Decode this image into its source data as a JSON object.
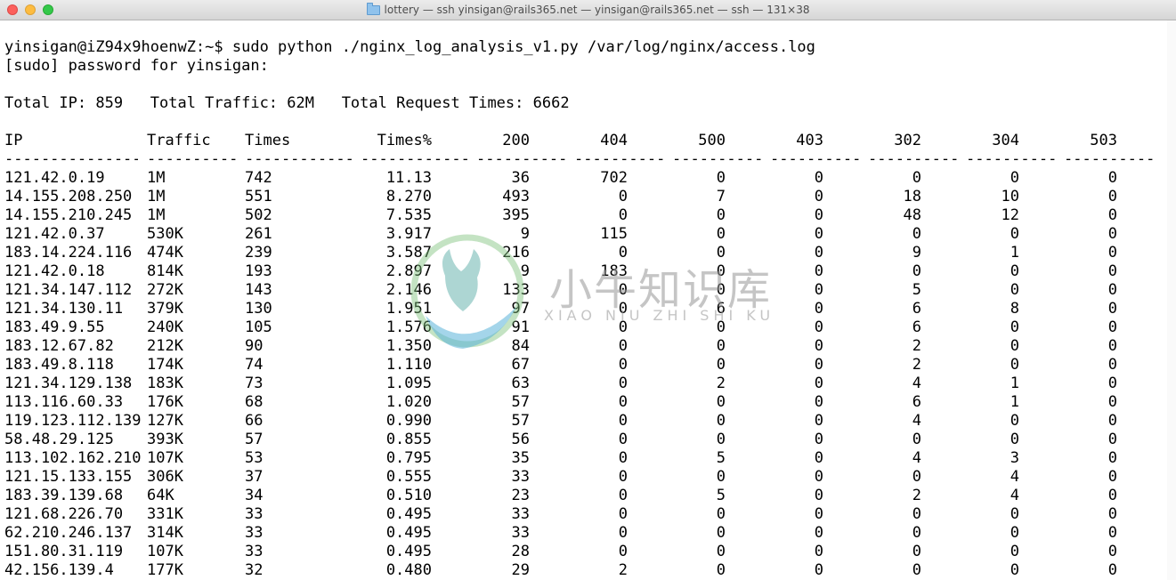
{
  "window": {
    "title": "lottery — ssh yinsigan@rails365.net — yinsigan@rails365.net — ssh — 131×38",
    "close_color": "#fc605c",
    "minimize_color": "#fdbc40",
    "maximize_color": "#34c84a"
  },
  "terminal": {
    "command_line": "yinsigan@iZ94x9hoenwZ:~$ sudo python ./nginx_log_analysis_v1.py /var/log/nginx/access.log",
    "sudo_prompt": "[sudo] password for yinsigan:",
    "summary": "Total IP: 859   Total Traffic: 62M   Total Request Times: 6662",
    "table": {
      "headers": {
        "ip": "IP",
        "traffic": "Traffic",
        "times": "Times",
        "pct": "Times%",
        "s200": "200",
        "s404": "404",
        "s500": "500",
        "s403": "403",
        "s302": "302",
        "s304": "304",
        "s503": "503"
      },
      "separators": {
        "ip": "---------------",
        "traffic": "----------",
        "times": "------------",
        "pct": "------------",
        "s200": "----------",
        "s404": "----------",
        "s500": "----------",
        "s403": "----------",
        "s302": "----------",
        "s304": "----------",
        "s503": "----------"
      },
      "rows": [
        {
          "ip": "121.42.0.19",
          "traffic": "1M",
          "times": "742",
          "pct": "11.13",
          "s200": "36",
          "s404": "702",
          "s500": "0",
          "s403": "0",
          "s302": "0",
          "s304": "0",
          "s503": "0"
        },
        {
          "ip": "14.155.208.250",
          "traffic": "1M",
          "times": "551",
          "pct": "8.270",
          "s200": "493",
          "s404": "0",
          "s500": "7",
          "s403": "0",
          "s302": "18",
          "s304": "10",
          "s503": "0"
        },
        {
          "ip": "14.155.210.245",
          "traffic": "1M",
          "times": "502",
          "pct": "7.535",
          "s200": "395",
          "s404": "0",
          "s500": "0",
          "s403": "0",
          "s302": "48",
          "s304": "12",
          "s503": "0"
        },
        {
          "ip": "121.42.0.37",
          "traffic": "530K",
          "times": "261",
          "pct": "3.917",
          "s200": "9",
          "s404": "115",
          "s500": "0",
          "s403": "0",
          "s302": "0",
          "s304": "0",
          "s503": "0"
        },
        {
          "ip": "183.14.224.116",
          "traffic": "474K",
          "times": "239",
          "pct": "3.587",
          "s200": "216",
          "s404": "0",
          "s500": "0",
          "s403": "0",
          "s302": "9",
          "s304": "1",
          "s503": "0"
        },
        {
          "ip": "121.42.0.18",
          "traffic": "814K",
          "times": "193",
          "pct": "2.897",
          "s200": "9",
          "s404": "183",
          "s500": "0",
          "s403": "0",
          "s302": "0",
          "s304": "0",
          "s503": "0"
        },
        {
          "ip": "121.34.147.112",
          "traffic": "272K",
          "times": "143",
          "pct": "2.146",
          "s200": "133",
          "s404": "0",
          "s500": "0",
          "s403": "0",
          "s302": "5",
          "s304": "0",
          "s503": "0"
        },
        {
          "ip": "121.34.130.11",
          "traffic": "379K",
          "times": "130",
          "pct": "1.951",
          "s200": "97",
          "s404": "0",
          "s500": "6",
          "s403": "0",
          "s302": "6",
          "s304": "8",
          "s503": "0"
        },
        {
          "ip": "183.49.9.55",
          "traffic": "240K",
          "times": "105",
          "pct": "1.576",
          "s200": "91",
          "s404": "0",
          "s500": "0",
          "s403": "0",
          "s302": "6",
          "s304": "0",
          "s503": "0"
        },
        {
          "ip": "183.12.67.82",
          "traffic": "212K",
          "times": "90",
          "pct": "1.350",
          "s200": "84",
          "s404": "0",
          "s500": "0",
          "s403": "0",
          "s302": "2",
          "s304": "0",
          "s503": "0"
        },
        {
          "ip": "183.49.8.118",
          "traffic": "174K",
          "times": "74",
          "pct": "1.110",
          "s200": "67",
          "s404": "0",
          "s500": "0",
          "s403": "0",
          "s302": "2",
          "s304": "0",
          "s503": "0"
        },
        {
          "ip": "121.34.129.138",
          "traffic": "183K",
          "times": "73",
          "pct": "1.095",
          "s200": "63",
          "s404": "0",
          "s500": "2",
          "s403": "0",
          "s302": "4",
          "s304": "1",
          "s503": "0"
        },
        {
          "ip": "113.116.60.33",
          "traffic": "176K",
          "times": "68",
          "pct": "1.020",
          "s200": "57",
          "s404": "0",
          "s500": "0",
          "s403": "0",
          "s302": "6",
          "s304": "1",
          "s503": "0"
        },
        {
          "ip": "119.123.112.139",
          "traffic": "127K",
          "times": "66",
          "pct": "0.990",
          "s200": "57",
          "s404": "0",
          "s500": "0",
          "s403": "0",
          "s302": "4",
          "s304": "0",
          "s503": "0"
        },
        {
          "ip": "58.48.29.125",
          "traffic": "393K",
          "times": "57",
          "pct": "0.855",
          "s200": "56",
          "s404": "0",
          "s500": "0",
          "s403": "0",
          "s302": "0",
          "s304": "0",
          "s503": "0"
        },
        {
          "ip": "113.102.162.210",
          "traffic": "107K",
          "times": "53",
          "pct": "0.795",
          "s200": "35",
          "s404": "0",
          "s500": "5",
          "s403": "0",
          "s302": "4",
          "s304": "3",
          "s503": "0"
        },
        {
          "ip": "121.15.133.155",
          "traffic": "306K",
          "times": "37",
          "pct": "0.555",
          "s200": "33",
          "s404": "0",
          "s500": "0",
          "s403": "0",
          "s302": "0",
          "s304": "4",
          "s503": "0"
        },
        {
          "ip": "183.39.139.68",
          "traffic": "64K",
          "times": "34",
          "pct": "0.510",
          "s200": "23",
          "s404": "0",
          "s500": "5",
          "s403": "0",
          "s302": "2",
          "s304": "4",
          "s503": "0"
        },
        {
          "ip": "121.68.226.70",
          "traffic": "331K",
          "times": "33",
          "pct": "0.495",
          "s200": "33",
          "s404": "0",
          "s500": "0",
          "s403": "0",
          "s302": "0",
          "s304": "0",
          "s503": "0"
        },
        {
          "ip": "62.210.246.137",
          "traffic": "314K",
          "times": "33",
          "pct": "0.495",
          "s200": "33",
          "s404": "0",
          "s500": "0",
          "s403": "0",
          "s302": "0",
          "s304": "0",
          "s503": "0"
        },
        {
          "ip": "151.80.31.119",
          "traffic": "107K",
          "times": "33",
          "pct": "0.495",
          "s200": "28",
          "s404": "0",
          "s500": "0",
          "s403": "0",
          "s302": "0",
          "s304": "0",
          "s503": "0"
        },
        {
          "ip": "42.156.139.4",
          "traffic": "177K",
          "times": "32",
          "pct": "0.480",
          "s200": "29",
          "s404": "2",
          "s500": "0",
          "s403": "0",
          "s302": "0",
          "s304": "0",
          "s503": "0"
        }
      ]
    }
  },
  "watermark": {
    "text": "小牛知识库",
    "subtext": "XIAO NIU ZHI SHI KU",
    "logo_icon": "bull-head-logo-icon",
    "colors": {
      "green": "#7cc17a",
      "blue": "#5ab3d8"
    }
  }
}
